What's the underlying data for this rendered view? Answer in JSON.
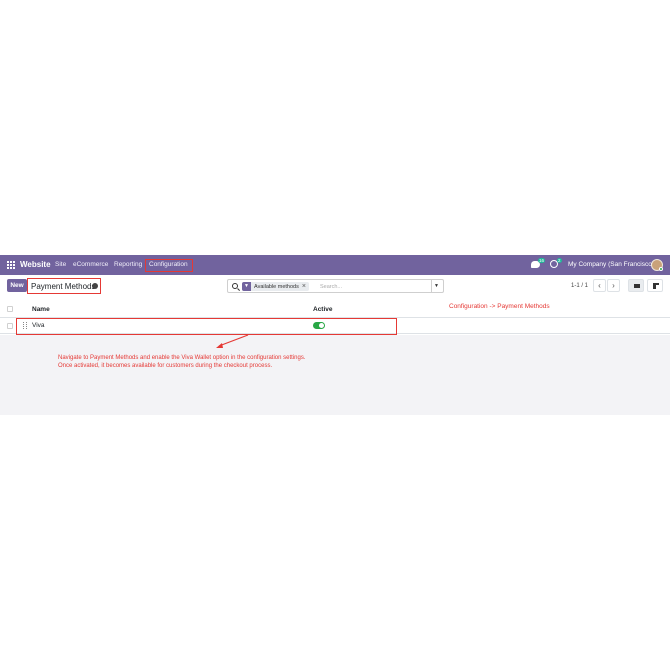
{
  "navbar": {
    "app_name": "Website",
    "menus": [
      "Site",
      "eCommerce",
      "Reporting",
      "Configuration"
    ],
    "messages_badge": "16",
    "activities_badge": "2",
    "company": "My Company (San Francisco)"
  },
  "control_panel": {
    "new_label": "New",
    "title": "Payment Methods",
    "search": {
      "facet_label": "Available methods",
      "placeholder": "Search..."
    },
    "pager": "1-1 / 1"
  },
  "list": {
    "columns": [
      "Name",
      "Active"
    ],
    "rows": [
      {
        "name": "Viva",
        "active": true
      }
    ]
  },
  "annotations": {
    "config_path": "Configuration -> Payment Methods",
    "instruction_line1": "Navigate to Payment Methods and enable the Viva Wallet option in the configuration settings.",
    "instruction_line2": "Once activated, it becomes available for customers during the checkout process."
  },
  "colors": {
    "brand": "#71639e",
    "annotation": "#e53935",
    "toggle_on": "#28a745"
  },
  "icons": [
    "apps-icon",
    "chat-icon",
    "activity-icon",
    "avatar",
    "gear-icon",
    "search-icon",
    "filter-icon",
    "close-icon",
    "caret-down-icon",
    "chevron-left-icon",
    "chevron-right-icon",
    "list-view-icon",
    "kanban-view-icon",
    "drag-handle-icon"
  ]
}
